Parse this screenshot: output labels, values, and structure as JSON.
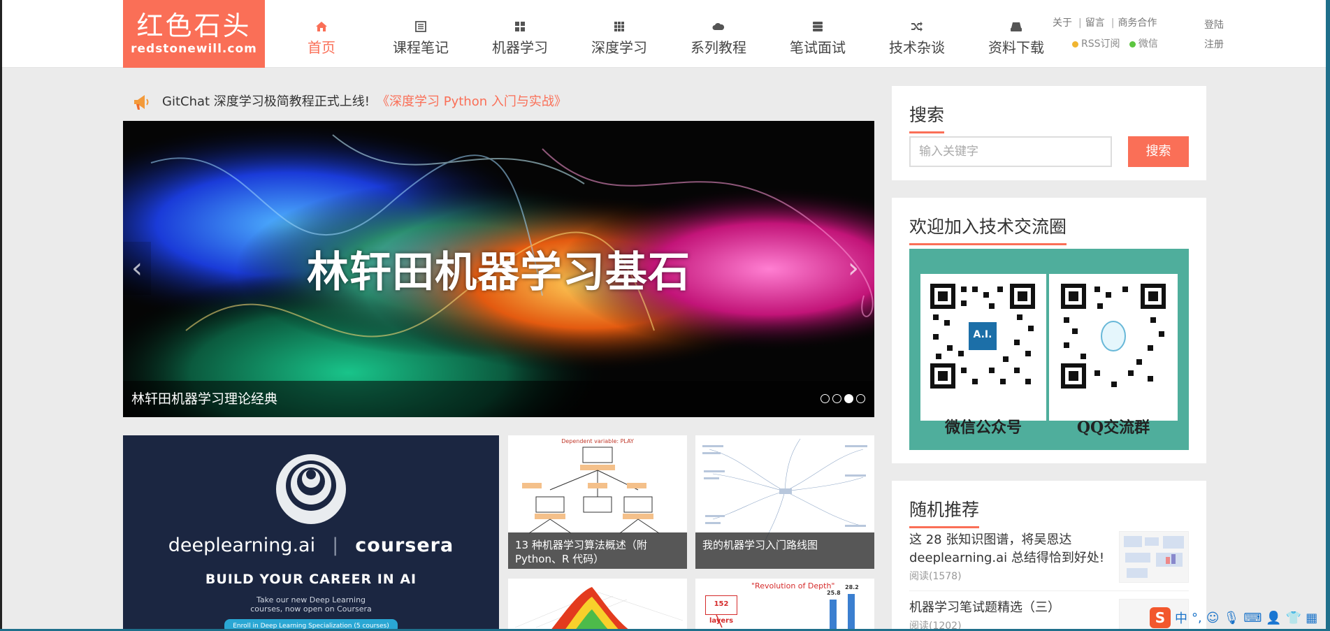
{
  "logo": {
    "cn": "红色石头",
    "en": "redstonewill.com"
  },
  "nav": [
    {
      "label": "首页",
      "icon": "home-icon"
    },
    {
      "label": "课程笔记",
      "icon": "notes-icon"
    },
    {
      "label": "机器学习",
      "icon": "grid-icon"
    },
    {
      "label": "深度学习",
      "icon": "dots-grid-icon"
    },
    {
      "label": "系列教程",
      "icon": "cloud-icon"
    },
    {
      "label": "笔试面试",
      "icon": "server-icon"
    },
    {
      "label": "技术杂谈",
      "icon": "shuffle-icon"
    },
    {
      "label": "资料下载",
      "icon": "drive-icon"
    }
  ],
  "top_links": {
    "about": "关于",
    "message": "留言",
    "business": "商务合作",
    "rss": "RSS订阅",
    "wechat": "微信",
    "login": "登陆",
    "register": "注册"
  },
  "announce": {
    "text": "GitChat 深度学习极简教程正式上线!",
    "link": "《深度学习 Python 入门与实战》"
  },
  "carousel": {
    "title": "林轩田机器学习基石",
    "caption": "林轩田机器学习理论经典",
    "slides": 4,
    "active": 3
  },
  "tiles": {
    "big": {
      "brand1": "deeplearning.ai",
      "brand2": "coursera",
      "headline": "BUILD YOUR CAREER IN AI",
      "sub1": "Take our new Deep Learning",
      "sub2": "courses, now open on Coursera",
      "cta": "Enroll in Deep Learning Specialization (5 courses)"
    },
    "t1": {
      "caption": "13 种机器学习算法概述（附 Python、R 代码）",
      "diagram_title": "Dependent variable: PLAY"
    },
    "t2": {
      "caption": "我的机器学习入门路线图"
    },
    "t4": {
      "caption": "\"Revolution of Depth\"",
      "badge": "152 layers",
      "v1": "25.8",
      "v2": "28.2"
    }
  },
  "sidebar": {
    "search": {
      "title": "搜索",
      "placeholder": "输入关键字",
      "button": "搜索"
    },
    "community": {
      "title": "欢迎加入技术交流圈",
      "qr1": "微信公众号",
      "qr2": "QQ交流群",
      "ai_badge": "A.I."
    },
    "random": {
      "title": "随机推荐",
      "items": [
        {
          "title": "这 28 张知识图谱，将吴恩达 deeplearning.ai 总结得恰到好处!",
          "meta": "阅读(1578)"
        },
        {
          "title": "机器学习笔试题精选（三）",
          "meta": "阅读(1202)"
        }
      ]
    }
  },
  "ime": {
    "s": "S",
    "zh": "中",
    "punct": "°,"
  }
}
